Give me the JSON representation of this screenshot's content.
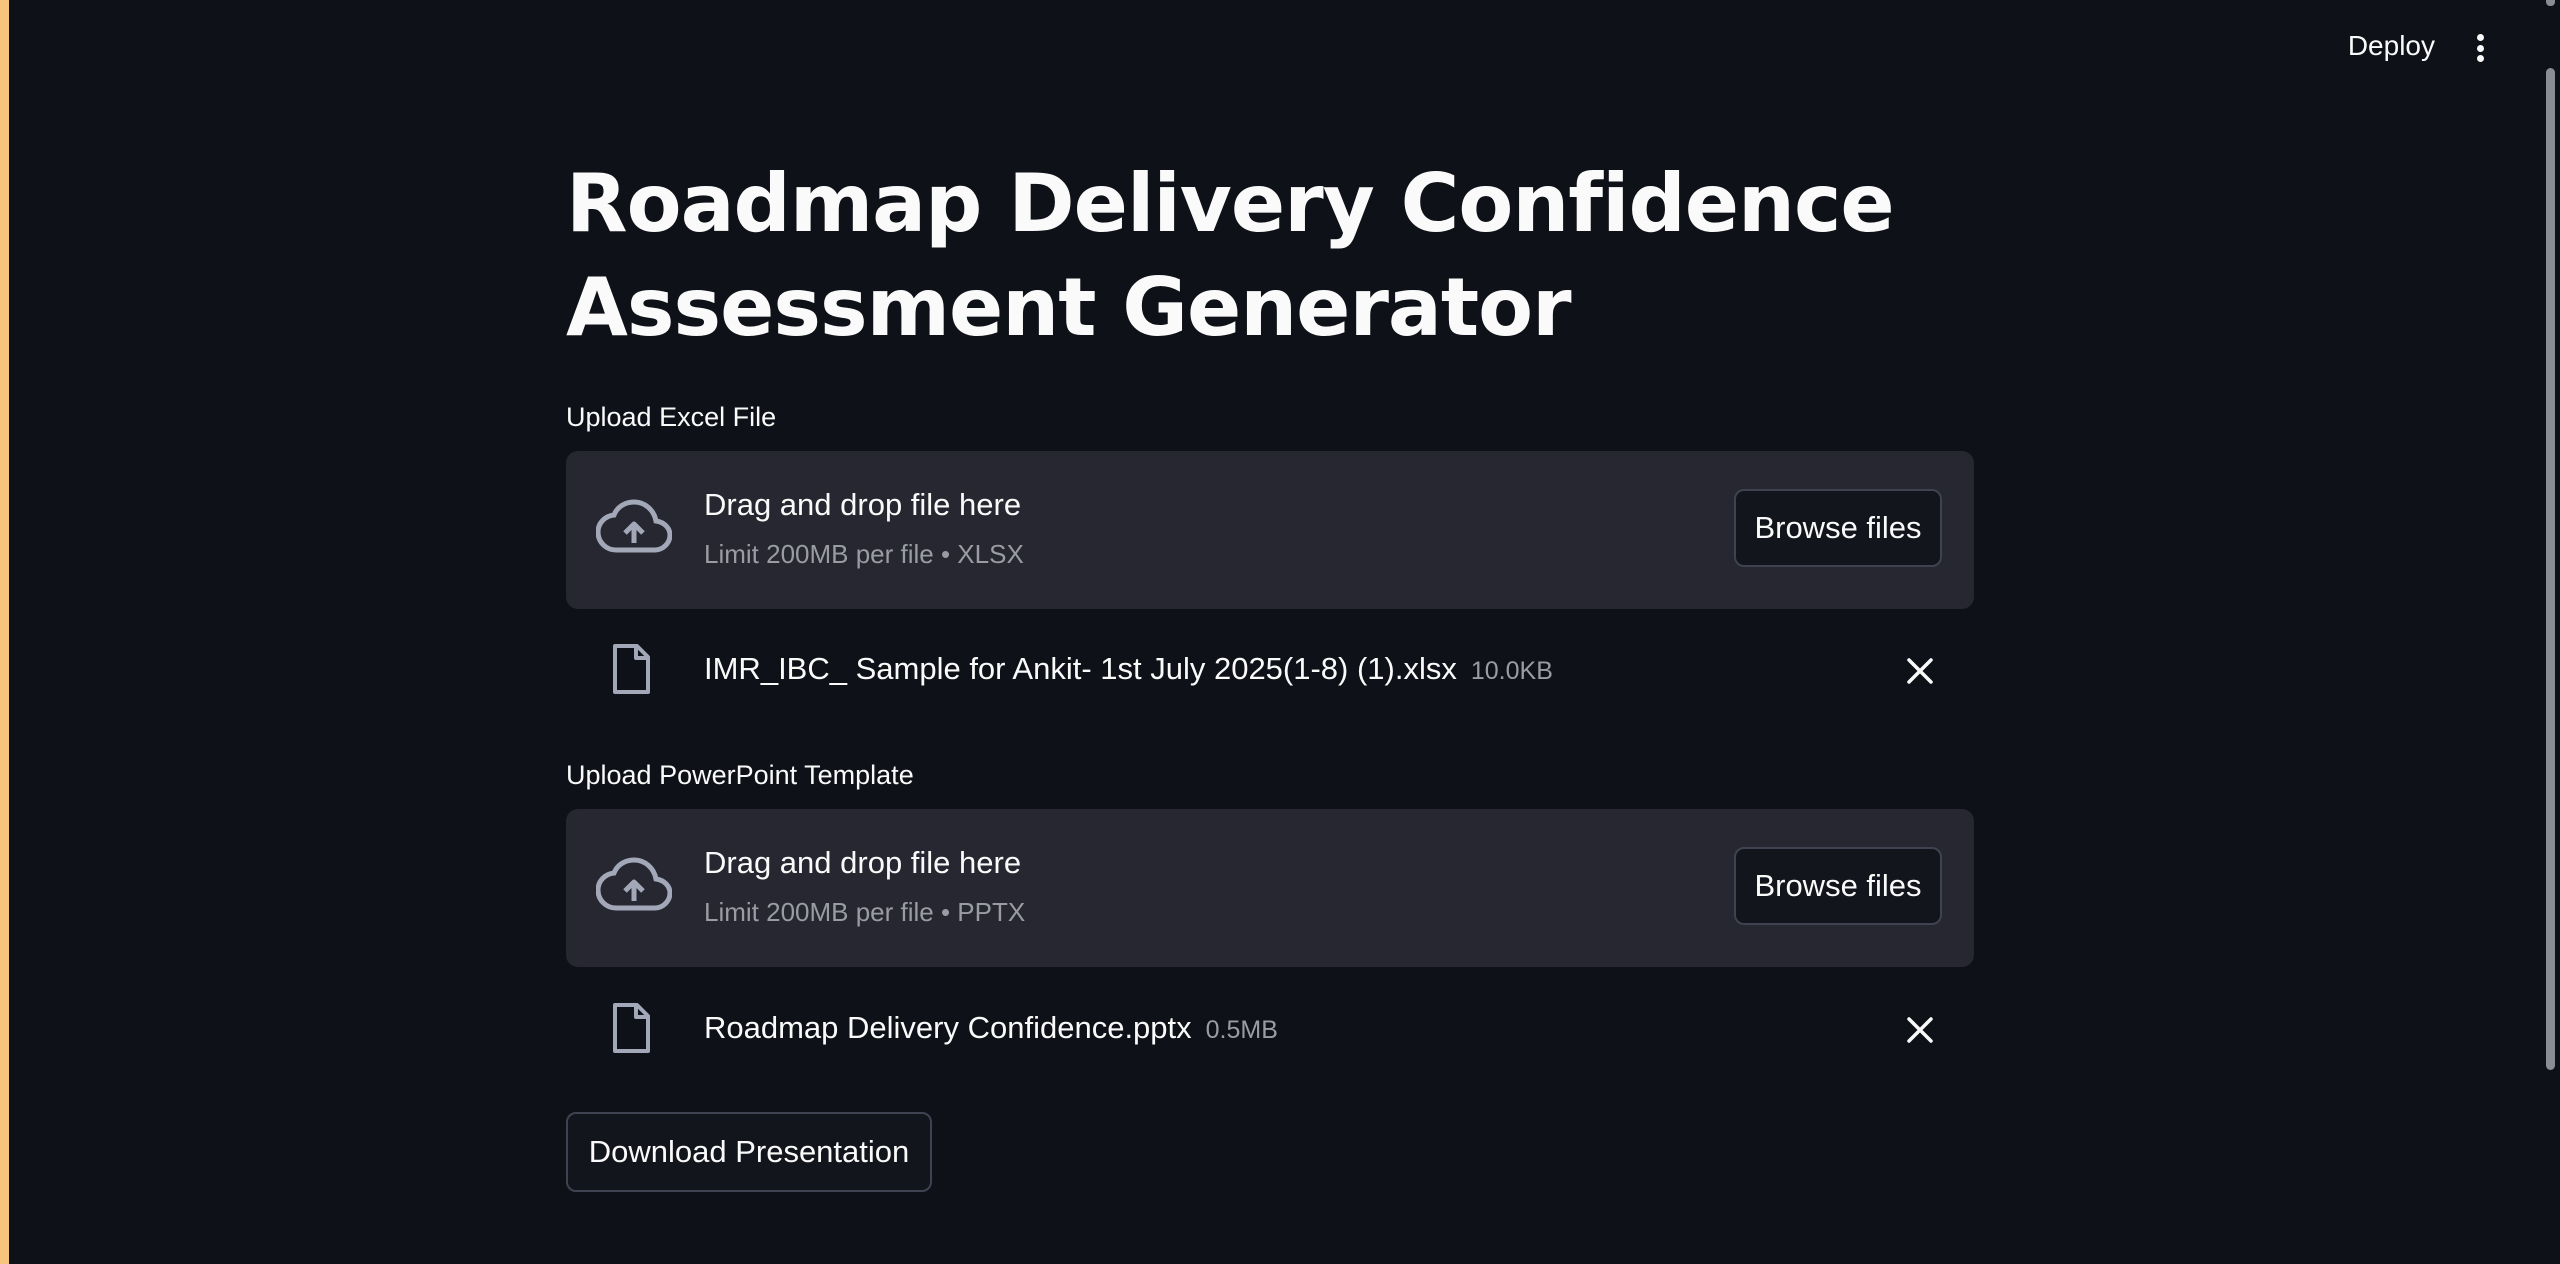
{
  "header": {
    "deploy_label": "Deploy",
    "menu_icon": "kebab-menu-icon"
  },
  "page": {
    "title": "Roadmap Delivery Confidence Assessment Generator"
  },
  "uploaders": [
    {
      "label": "Upload Excel File",
      "dropzone_title": "Drag and drop file here",
      "dropzone_subtitle": "Limit 200MB per file • XLSX",
      "browse_label": "Browse files",
      "file": {
        "name": "IMR_IBC_ Sample for Ankit- 1st July 2025(1-8) (1).xlsx",
        "size": "10.0KB"
      }
    },
    {
      "label": "Upload PowerPoint Template",
      "dropzone_title": "Drag and drop file here",
      "dropzone_subtitle": "Limit 200MB per file • PPTX",
      "browse_label": "Browse files",
      "file": {
        "name": "Roadmap Delivery Confidence.pptx",
        "size": "0.5MB"
      }
    }
  ],
  "actions": {
    "download_label": "Download Presentation"
  },
  "colors": {
    "background": "#0e1117",
    "dropzone": "#262730",
    "muted_text": "#9a9ca3",
    "left_accent": "#f6c47a"
  }
}
